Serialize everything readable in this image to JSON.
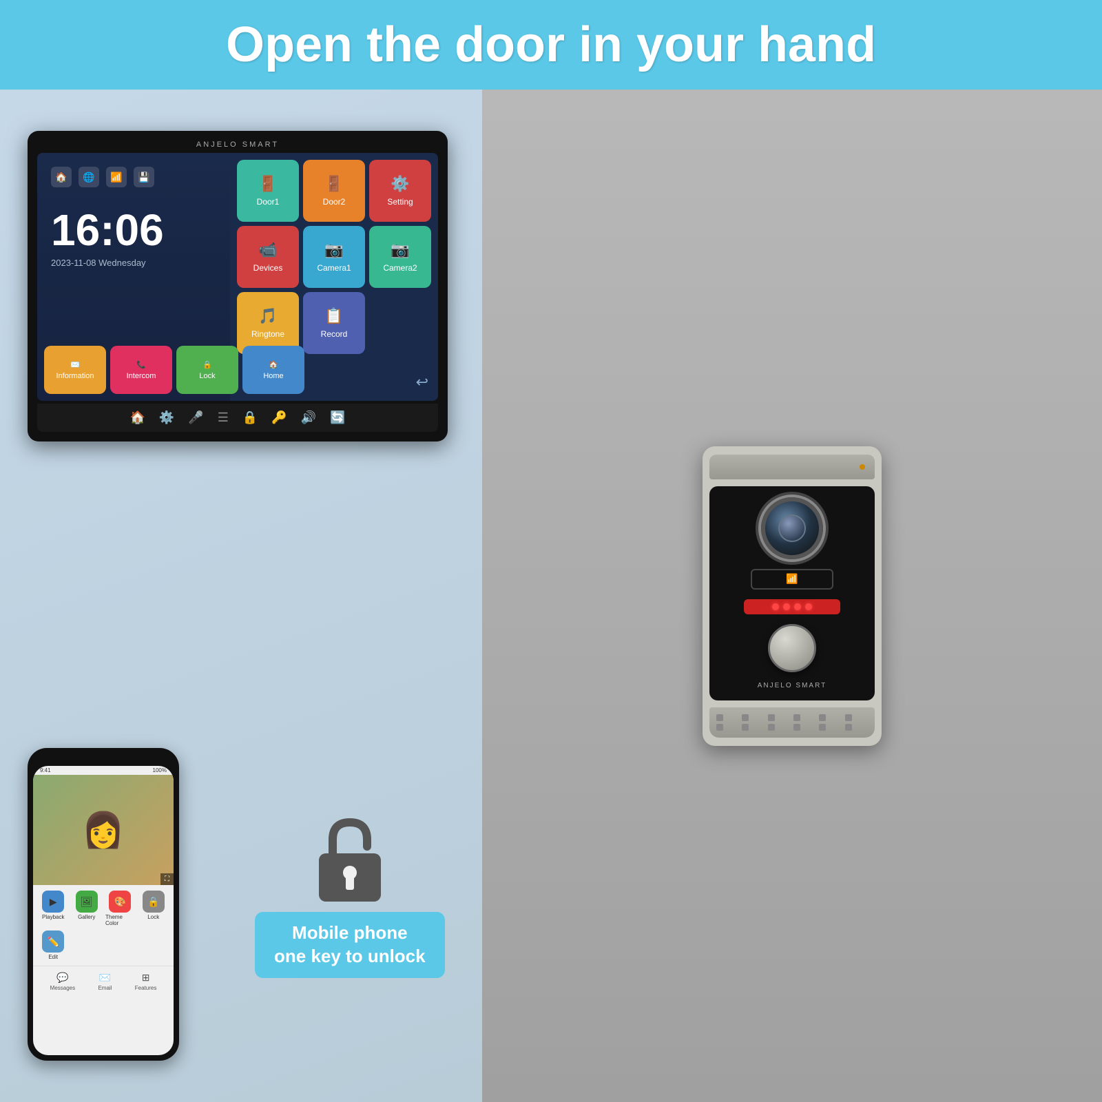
{
  "header": {
    "title": "Open the door in your hand",
    "bg_color": "#5bc8e8"
  },
  "monitor": {
    "brand": "ANJELO SMART",
    "clock": {
      "time": "16:06",
      "date": "2023-11-08 Wednesday"
    },
    "icons_top": [
      "🏠",
      "🌐",
      "📶",
      "💾"
    ],
    "app_tiles": [
      {
        "label": "Door1",
        "icon": "🚪",
        "class": "tile-door1"
      },
      {
        "label": "Door2",
        "icon": "🚪",
        "class": "tile-door2"
      },
      {
        "label": "Setting",
        "icon": "⚙️",
        "class": "tile-setting"
      },
      {
        "label": "Devices",
        "icon": "📹",
        "class": "tile-devices"
      },
      {
        "label": "Camera1",
        "icon": "📷",
        "class": "tile-camera1"
      },
      {
        "label": "Camera2",
        "icon": "📷",
        "class": "tile-camera2"
      },
      {
        "label": "Ringtone",
        "icon": "🎵",
        "class": "tile-ringtone"
      },
      {
        "label": "Record",
        "icon": "📋",
        "class": "tile-record"
      }
    ],
    "bottom_apps": [
      {
        "label": "Information",
        "icon": "✉️",
        "class": "app-info"
      },
      {
        "label": "Intercom",
        "icon": "📞",
        "class": "app-intercom"
      },
      {
        "label": "Lock",
        "icon": "🔒",
        "class": "app-lock"
      },
      {
        "label": "Home",
        "icon": "🏠",
        "class": "app-home"
      }
    ]
  },
  "phone": {
    "status": "100%",
    "apps": [
      {
        "label": "Playback",
        "icon": "▶",
        "color": "#4488cc"
      },
      {
        "label": "Gallery",
        "icon": "🖼",
        "color": "#44aa44"
      },
      {
        "label": "Theme Color",
        "icon": "🎨",
        "color": "#ee4444"
      },
      {
        "label": "Lock",
        "icon": "🔒",
        "color": "#888888"
      },
      {
        "label": "Edit",
        "icon": "✏️",
        "color": "#5599cc"
      }
    ],
    "nav": [
      {
        "label": "Messages",
        "icon": "💬"
      },
      {
        "label": "Email",
        "icon": "✉️"
      },
      {
        "label": "Features",
        "icon": "⊞"
      }
    ]
  },
  "unlock": {
    "label": "Mobile phone\none key to unlock"
  },
  "outdoor_unit": {
    "brand": "ANJELO SMART"
  }
}
